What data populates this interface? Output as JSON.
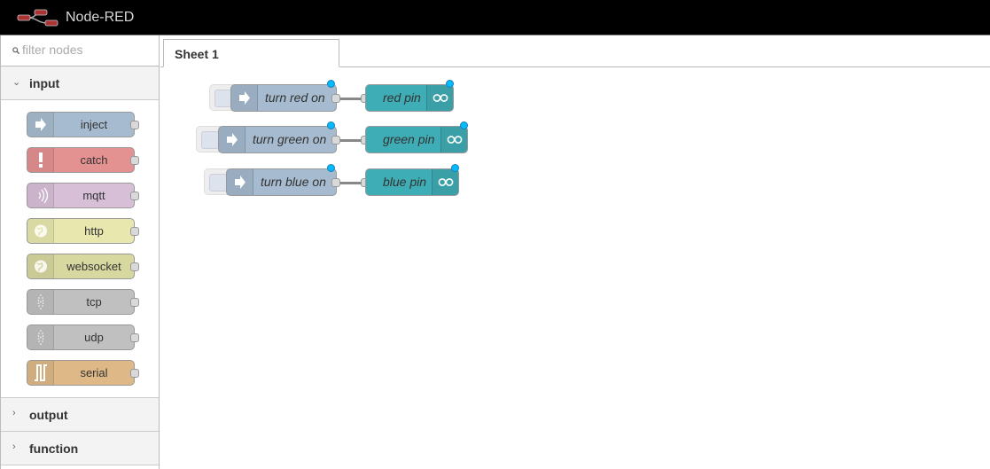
{
  "header": {
    "title": "Node-RED",
    "logo_icon": "node-red-logo-icon"
  },
  "sidebar": {
    "filter": {
      "placeholder": "filter nodes",
      "value": "",
      "icon": "search-icon"
    },
    "categories": [
      {
        "label": "input",
        "expanded": true,
        "chevron": "chevron-down-icon"
      },
      {
        "label": "output",
        "expanded": false,
        "chevron": "chevron-right-icon"
      },
      {
        "label": "function",
        "expanded": false,
        "chevron": "chevron-right-icon"
      }
    ],
    "input_nodes": [
      {
        "label": "inject",
        "icon": "inject-arrow-icon",
        "color": "#a6bbcf"
      },
      {
        "label": "catch",
        "icon": "alert-icon",
        "color": "#e49191"
      },
      {
        "label": "mqtt",
        "icon": "bridge-signal-icon",
        "color": "#d8bfd8"
      },
      {
        "label": "http",
        "icon": "globe-icon",
        "color": "#e7e7ae"
      },
      {
        "label": "websocket",
        "icon": "globe-icon",
        "color": "#d7d7a0"
      },
      {
        "label": "tcp",
        "icon": "bridge-dots-icon",
        "color": "#c0c0c0"
      },
      {
        "label": "udp",
        "icon": "bridge-dots-icon",
        "color": "#c0c0c0"
      },
      {
        "label": "serial",
        "icon": "serial-wave-icon",
        "color": "#deb887"
      }
    ]
  },
  "workspace": {
    "tabs": [
      {
        "label": "Sheet 1",
        "active": true
      }
    ],
    "flows": [
      {
        "inject": "turn red on",
        "output": "red pin"
      },
      {
        "inject": "turn green on",
        "output": "green pin"
      },
      {
        "inject": "turn blue on",
        "output": "blue pin"
      }
    ],
    "colors": {
      "inject": "#a6bbcf",
      "arduino": "#3fadb5",
      "changed_badge": "#00bcff"
    }
  }
}
